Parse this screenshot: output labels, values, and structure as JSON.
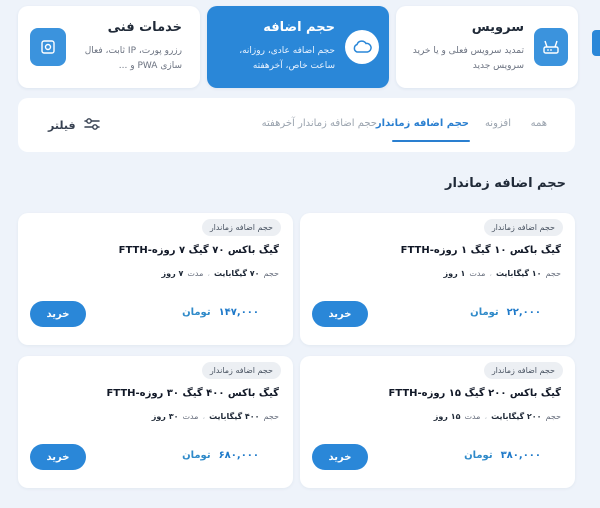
{
  "services": [
    {
      "title": "سرویس",
      "desc": "تمدید سرویس فعلی و یا خرید سرویس جدید",
      "icon": "router-icon"
    },
    {
      "title": "حجم اضافه",
      "desc": "حجم اضافه عادی، روزانه، ساعت خاص، آخرهفته",
      "icon": "cloud-icon"
    },
    {
      "title": "خدمات فنی",
      "desc": "رزرو پورت، IP ثابت، فعال سازی PWA و ...",
      "icon": "tools-icon"
    }
  ],
  "tabs": {
    "all": "همه",
    "addons": "افزونه",
    "timed": "حجم اضافه زماندار",
    "weekend": "حجم اضافه زماندار آخرهفته",
    "filter": "فیلتر"
  },
  "section_title": "حجم اضافه زماندار",
  "labels": {
    "volume": "حجم",
    "duration": "مدت",
    "currency": "تومان",
    "buy": "خرید"
  },
  "packages": [
    {
      "badge": "حجم اضافه زماندار",
      "name": "گیگ باکس ۱۰ گیگ ۱ روزه-FTTH",
      "volume": "۱۰ گیگابایت",
      "duration": "۱ روز",
      "price": "۲۲,۰۰۰"
    },
    {
      "badge": "حجم اضافه زماندار",
      "name": "گیگ باکس ۷۰ گیگ ۷ روزه-FTTH",
      "volume": "۷۰ گیگابایت",
      "duration": "۷ روز",
      "price": "۱۴۷,۰۰۰"
    },
    {
      "badge": "حجم اضافه زماندار",
      "name": "گیگ باکس ۲۰۰ گیگ ۱۵ روزه-FTTH",
      "volume": "۲۰۰ گیگابایت",
      "duration": "۱۵ روز",
      "price": "۳۸۰,۰۰۰"
    },
    {
      "badge": "حجم اضافه زماندار",
      "name": "گیگ باکس ۴۰۰ گیگ ۳۰ روزه-FTTH",
      "volume": "۴۰۰ گیگابایت",
      "duration": "۳۰ روز",
      "price": "۶۸۰,۰۰۰"
    }
  ],
  "colors": {
    "accent": "#2a87d8",
    "background": "#eef3fa",
    "price": "#1e79c9"
  }
}
